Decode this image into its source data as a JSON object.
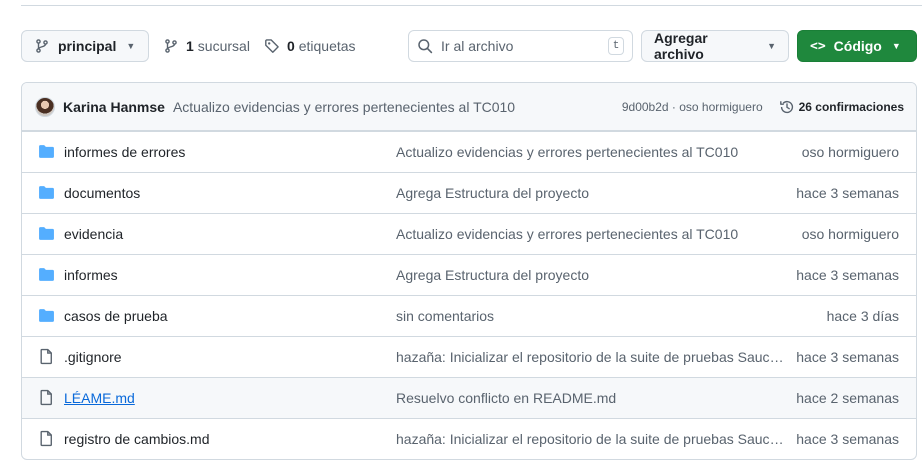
{
  "toolbar": {
    "branch_label": "principal",
    "branches_count": "1",
    "branches_label": "sucursal",
    "tags_count": "0",
    "tags_label": "etiquetas",
    "search_placeholder": "Ir al archivo",
    "search_shortcut": "t",
    "add_file_label": "Agregar archivo",
    "code_label": "Código",
    "code_glyph": "<>"
  },
  "latest_commit": {
    "author": "Karina Hanmse",
    "message": "Actualizo evidencias y errores pertenecientes al TC010",
    "hash_and_author": "9d00b2d · oso hormiguero",
    "commits_count_label": "26 confirmaciones"
  },
  "files": [
    {
      "type": "folder",
      "name": "informes de errores",
      "message": "Actualizo evidencias y errores pertenecientes al TC010",
      "date": "oso hormiguero"
    },
    {
      "type": "folder",
      "name": "documentos",
      "message": "Agrega Estructura del proyecto",
      "date": "hace 3 semanas"
    },
    {
      "type": "folder",
      "name": "evidencia",
      "message": "Actualizo evidencias y errores pertenecientes al TC010",
      "date": "oso hormiguero"
    },
    {
      "type": "folder",
      "name": "informes",
      "message": "Agrega Estructura del proyecto",
      "date": "hace 3 semanas"
    },
    {
      "type": "folder",
      "name": "casos de prueba",
      "message": "sin comentarios",
      "date": "hace 3 días"
    },
    {
      "type": "file",
      "name": ".gitignore",
      "message": "hazaña: Inicializar el repositorio de la suite de pruebas Sauce...",
      "date": "hace 3 semanas"
    },
    {
      "type": "file",
      "name": "LÉAME.md",
      "message": "Resuelvo conflicto en README.md",
      "date": "hace 2 semanas"
    },
    {
      "type": "file",
      "name": "registro de cambios.md",
      "message": "hazaña: Inicializar el repositorio de la suite de pruebas Sauce...",
      "date": "hace 3 semanas"
    }
  ],
  "colors": {
    "folder": "#54aeff",
    "primary_button": "#1f883d",
    "link": "#0969da"
  }
}
